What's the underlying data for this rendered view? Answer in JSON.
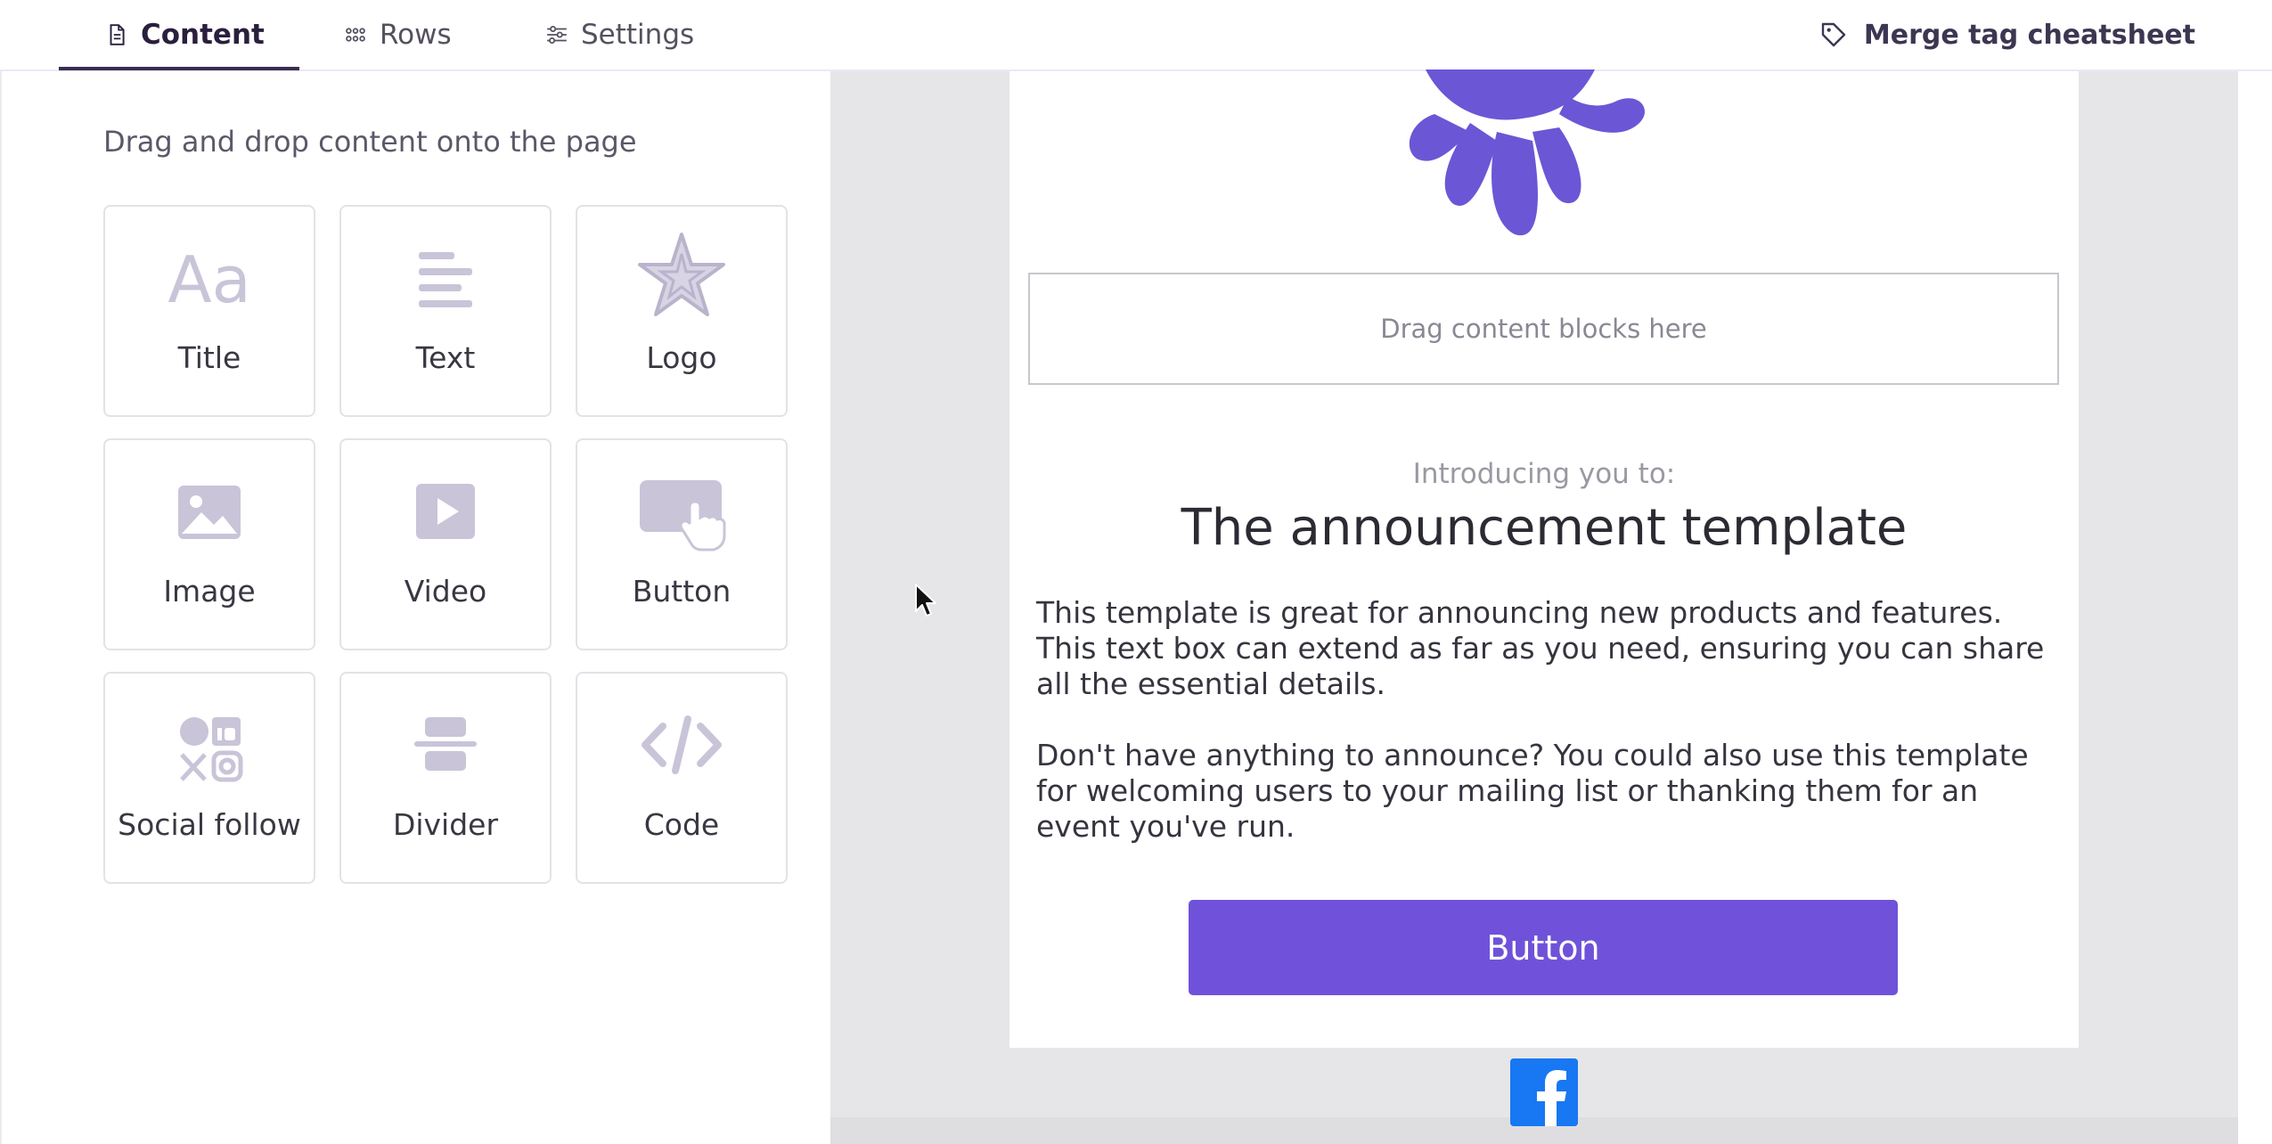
{
  "tabs": [
    {
      "label": "Content",
      "icon": "document-icon",
      "active": true
    },
    {
      "label": "Rows",
      "icon": "grid-dots-icon",
      "active": false
    },
    {
      "label": "Settings",
      "icon": "sliders-icon",
      "active": false
    }
  ],
  "merge_tag": {
    "label": "Merge tag cheatsheet",
    "icon": "tag-icon"
  },
  "panel": {
    "hint": "Drag and drop content onto the page",
    "blocks": [
      {
        "label": "Title",
        "icon": "title-aa-icon"
      },
      {
        "label": "Text",
        "icon": "text-lines-icon"
      },
      {
        "label": "Logo",
        "icon": "starfish-logo-icon"
      },
      {
        "label": "Image",
        "icon": "image-icon"
      },
      {
        "label": "Video",
        "icon": "video-play-icon"
      },
      {
        "label": "Button",
        "icon": "button-click-icon"
      },
      {
        "label": "Social follow",
        "icon": "social-icons-icon"
      },
      {
        "label": "Divider",
        "icon": "divider-icon"
      },
      {
        "label": "Code",
        "icon": "code-icon"
      }
    ]
  },
  "email": {
    "dropzone": "Drag content blocks here",
    "intro": "Introducing you to:",
    "headline": "The announcement template",
    "paragraph1": "This template is great for announcing new products and features. This text box can extend as far as you need, ensuring you can share all the essential details.",
    "paragraph2": "Don't have anything to announce? You could also use this template for welcoming users to your mailing list or thanking them for an event you've run.",
    "button": "Button",
    "social_icon": "facebook-icon"
  },
  "colors": {
    "accent": "#6f52d9",
    "facebook": "#1877f2",
    "icon_tint": "#c9c4d8",
    "canvas_bg": "#e6e6e8"
  }
}
